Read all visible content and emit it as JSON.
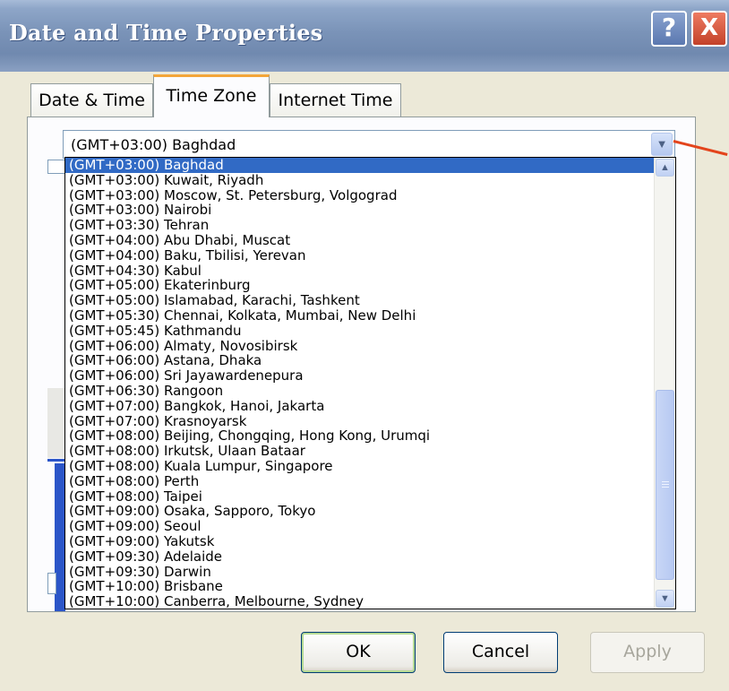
{
  "window": {
    "title": "Date and Time Properties",
    "help_label": "?",
    "close_label": "X"
  },
  "tabs": [
    {
      "label": "Date & Time",
      "active": false
    },
    {
      "label": "Time Zone",
      "active": true
    },
    {
      "label": "Internet Time",
      "active": false
    }
  ],
  "timezone": {
    "selected": "(GMT+03:00) Baghdad",
    "options": [
      "(GMT+03:00) Baghdad",
      "(GMT+03:00) Kuwait, Riyadh",
      "(GMT+03:00) Moscow, St. Petersburg, Volgograd",
      "(GMT+03:00) Nairobi",
      "(GMT+03:30) Tehran",
      "(GMT+04:00) Abu Dhabi, Muscat",
      "(GMT+04:00) Baku, Tbilisi, Yerevan",
      "(GMT+04:30) Kabul",
      "(GMT+05:00) Ekaterinburg",
      "(GMT+05:00) Islamabad, Karachi, Tashkent",
      "(GMT+05:30) Chennai, Kolkata, Mumbai, New Delhi",
      "(GMT+05:45) Kathmandu",
      "(GMT+06:00) Almaty, Novosibirsk",
      "(GMT+06:00) Astana, Dhaka",
      "(GMT+06:00) Sri Jayawardenepura",
      "(GMT+06:30) Rangoon",
      "(GMT+07:00) Bangkok, Hanoi, Jakarta",
      "(GMT+07:00) Krasnoyarsk",
      "(GMT+08:00) Beijing, Chongqing, Hong Kong, Urumqi",
      "(GMT+08:00) Irkutsk, Ulaan Bataar",
      "(GMT+08:00) Kuala Lumpur, Singapore",
      "(GMT+08:00) Perth",
      "(GMT+08:00) Taipei",
      "(GMT+09:00) Osaka, Sapporo, Tokyo",
      "(GMT+09:00) Seoul",
      "(GMT+09:00) Yakutsk",
      "(GMT+09:30) Adelaide",
      "(GMT+09:30) Darwin",
      "(GMT+10:00) Brisbane",
      "(GMT+10:00) Canberra, Melbourne, Sydney"
    ]
  },
  "buttons": {
    "ok": "OK",
    "cancel": "Cancel",
    "apply": "Apply"
  },
  "colors": {
    "selection": "#316ac5",
    "pointer_line": "#e3441c"
  }
}
